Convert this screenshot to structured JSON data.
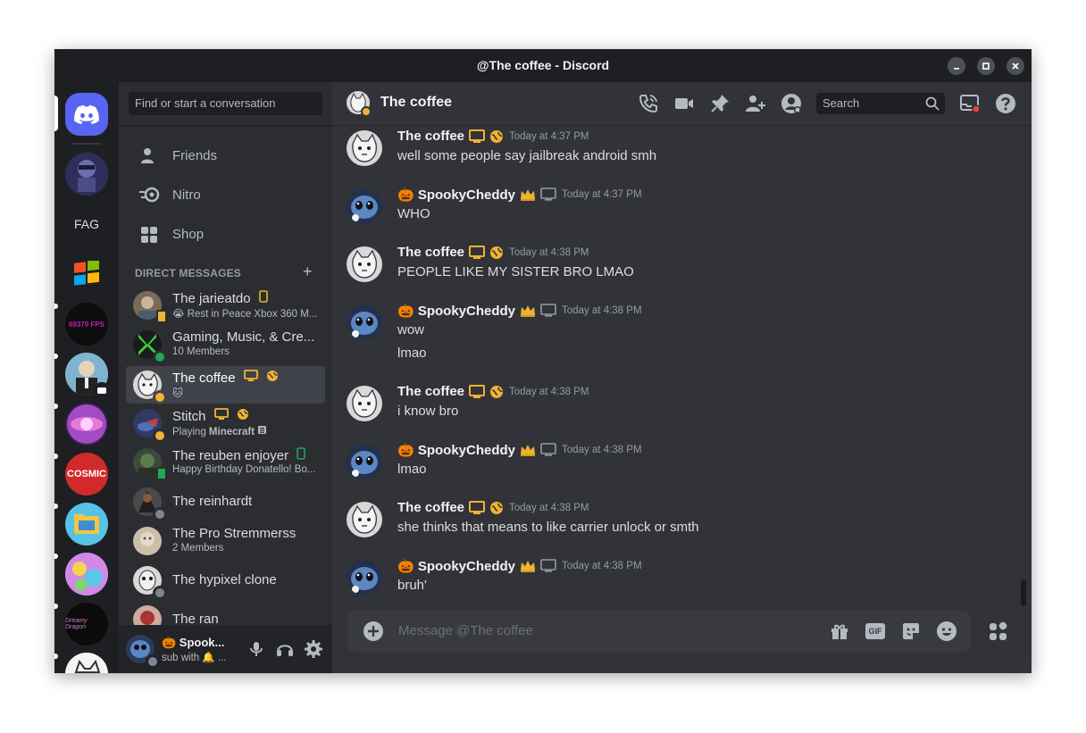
{
  "window": {
    "title": "@The coffee - Discord",
    "controls": [
      "minimize-icon",
      "maximize-icon",
      "close-icon"
    ]
  },
  "rail": {
    "servers": [
      {
        "name": "discord-home"
      },
      {
        "name": "server-avatar-1"
      },
      {
        "name": "server-fag",
        "label": "FAG"
      },
      {
        "name": "server-windows"
      },
      {
        "name": "server-fps",
        "label": "69379 FPS"
      },
      {
        "name": "server-suit"
      },
      {
        "name": "server-orb"
      },
      {
        "name": "server-cosmic",
        "label": "COSMIC"
      },
      {
        "name": "server-folder"
      },
      {
        "name": "server-art"
      },
      {
        "name": "server-dark",
        "label": "Dreamy Dragon"
      },
      {
        "name": "server-sketch"
      }
    ]
  },
  "sidebar": {
    "search_placeholder": "Find or start a conversation",
    "nav": [
      {
        "label": "Friends",
        "icon": "friends-icon"
      },
      {
        "label": "Nitro",
        "icon": "nitro-icon"
      },
      {
        "label": "Shop",
        "icon": "shop-icon"
      }
    ],
    "dm_header": "DIRECT MESSAGES",
    "dms": [
      {
        "name": "The jarieatdo",
        "sub": "😭 Rest in Peace Xbox 360 M...",
        "status": "mobile",
        "badges": [
          "mobile"
        ]
      },
      {
        "name": "Gaming, Music, & Cre...",
        "sub": "10 Members",
        "status": "group"
      },
      {
        "name": "The coffee",
        "sub": "🐱",
        "status": "idle",
        "badges": [
          "desktop",
          "web"
        ],
        "selected": true
      },
      {
        "name": "Stitch",
        "sub_prefix": "Playing ",
        "sub_bold": "Minecraft",
        "status": "idle",
        "badges": [
          "desktop",
          "web"
        ]
      },
      {
        "name": "The reuben enjoyer",
        "sub": "Happy Birthday Donatello! Bo...",
        "status": "mobile",
        "badges": [
          "mobile"
        ]
      },
      {
        "name": "The reinhardt",
        "status": "offline"
      },
      {
        "name": "The Pro Stremmerss",
        "sub": "2 Members",
        "status": "group"
      },
      {
        "name": "The hypixel clone",
        "status": "offline"
      },
      {
        "name": "The ran",
        "status": "offline"
      }
    ],
    "user_panel": {
      "name": "🎃 Spook...",
      "status": "sub with 🔔 ..."
    }
  },
  "chat": {
    "recipient": "The coffee",
    "search_placeholder": "Search",
    "messages": [
      {
        "author": "The coffee",
        "time": "Today at 4:37 PM",
        "lines": [
          "well some people say jailbreak android smh"
        ],
        "kind": "coffee"
      },
      {
        "author": "🎃 SpookyCheddy",
        "time": "Today at 4:37 PM",
        "lines": [
          "WHO"
        ],
        "kind": "spooky"
      },
      {
        "author": "The coffee",
        "time": "Today at 4:38 PM",
        "lines": [
          "PEOPLE LIKE MY SISTER BRO LMAO"
        ],
        "kind": "coffee"
      },
      {
        "author": "🎃 SpookyCheddy",
        "time": "Today at 4:38 PM",
        "lines": [
          "wow",
          "lmao"
        ],
        "kind": "spooky"
      },
      {
        "author": "The coffee",
        "time": "Today at 4:38 PM",
        "lines": [
          "i know bro"
        ],
        "kind": "coffee"
      },
      {
        "author": "🎃 SpookyCheddy",
        "time": "Today at 4:38 PM",
        "lines": [
          "lmao"
        ],
        "kind": "spooky"
      },
      {
        "author": "The coffee",
        "time": "Today at 4:38 PM",
        "lines": [
          "she thinks that means to like carrier unlock or smth"
        ],
        "kind": "coffee"
      },
      {
        "author": "🎃 SpookyCheddy",
        "time": "Today at 4:38 PM",
        "lines": [
          "bruh'"
        ],
        "kind": "spooky"
      }
    ],
    "composer_placeholder": "Message @The coffee",
    "gif_label": "GIF"
  },
  "colors": {
    "blurple": "#5865f2",
    "idle": "#f0b232",
    "online": "#23a55a",
    "offline": "#80848e",
    "crown": "#f0b232",
    "badge_gold": "#f0b232"
  }
}
